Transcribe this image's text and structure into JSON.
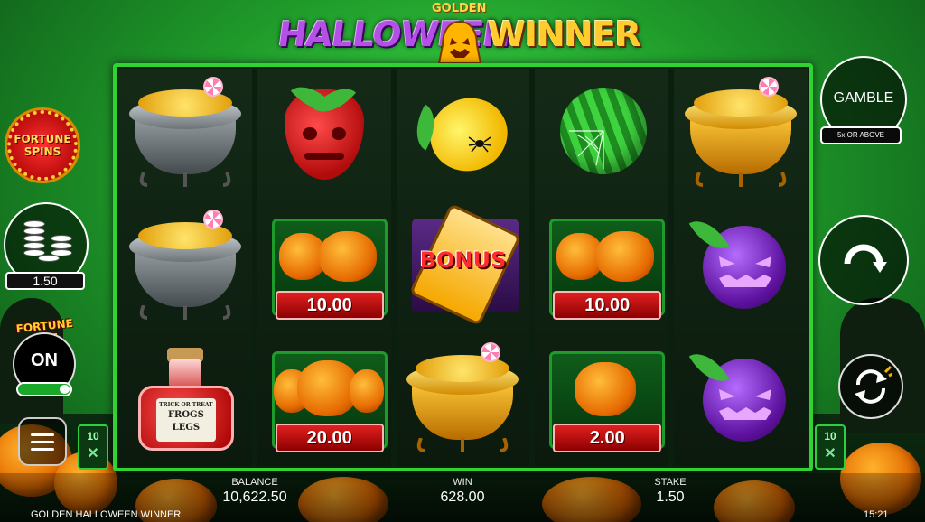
{
  "title": {
    "word1": "HALLOWEEN",
    "word_small": "GOLDEN",
    "word2": "WINNER"
  },
  "left_panel": {
    "fortune_spins": "FORTUNE SPINS",
    "stake_value": "1.50",
    "fortune_bet_label": "FORTUNE BET",
    "fortune_bet_state": "ON",
    "fortune_bet_enabled": true,
    "lines_badge_value": "10",
    "lines_badge_icon": "x-icon"
  },
  "right_panel": {
    "gamble_label": "GAMBLE",
    "gamble_sub": "5x OR ABOVE",
    "spin_icon": "refresh-arrow-icon",
    "autoplay_icon": "autoplay-icon",
    "lines_badge_value": "10"
  },
  "reels": [
    [
      "silver-cauldron",
      "silver-cauldron",
      "potion"
    ],
    [
      "strawberry",
      "pumpkin-prize",
      "pumpkin-prize"
    ],
    [
      "lemon",
      "bonus",
      "gold-cauldron"
    ],
    [
      "watermelon",
      "pumpkin-prize",
      "pumpkin-prize"
    ],
    [
      "gold-cauldron",
      "plum",
      "plum"
    ]
  ],
  "prizes": {
    "reel2_row2": "10.00",
    "reel2_row3": "20.00",
    "reel4_row2": "10.00",
    "reel4_row3": "2.00"
  },
  "bonus_text": "BONUS",
  "potion_label": {
    "top": "TRICK OR TREAT",
    "line1": "FROGS",
    "line2": "LEGS"
  },
  "info_bar": {
    "balance_label": "BALANCE",
    "balance_value": "10,622.50",
    "win_label": "WIN",
    "win_value": "628.00",
    "stake_label": "STAKE",
    "stake_value": "1.50",
    "game_name": "GOLDEN HALLOWEEN WINNER",
    "clock": "15:21"
  },
  "colors": {
    "frame": "#33d233",
    "prize_red": "#e02020",
    "title_purple": "#b450e6",
    "title_gold": "#ffcc2e"
  }
}
